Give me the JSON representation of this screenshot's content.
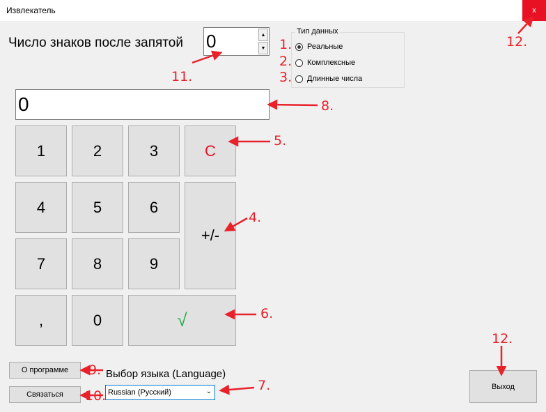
{
  "window": {
    "title": "Извлекатель",
    "close_label": "x"
  },
  "decimals": {
    "label": "Число знаков после запятой",
    "value": "0"
  },
  "data_type": {
    "title": "Тип данных",
    "options": [
      {
        "label": "Реальные",
        "selected": true
      },
      {
        "label": "Комплексные",
        "selected": false
      },
      {
        "label": "Длинные числа",
        "selected": false
      }
    ]
  },
  "display": {
    "value": "0"
  },
  "keypad": {
    "k1": "1",
    "k2": "2",
    "k3": "3",
    "clear": "C",
    "k4": "4",
    "k5": "5",
    "k6": "6",
    "sign": "+/-",
    "k7": "7",
    "k8": "8",
    "k9": "9",
    "comma": ",",
    "k0": "0",
    "sqrt": "√"
  },
  "about_button": "О программе",
  "contact_button": "Связаться",
  "language": {
    "label": "Выбор языка (Language)",
    "selected": "Russian (Русский)"
  },
  "exit_button": "Выход",
  "annotations": {
    "a1": "1.",
    "a2": "2.",
    "a3": "3.",
    "a4": "4.",
    "a5": "5.",
    "a6": "6.",
    "a7": "7.",
    "a8": "8.",
    "a9": "9.",
    "a10": "10.",
    "a11": "11.",
    "a12_top": "12.",
    "a12_bottom": "12."
  },
  "colors": {
    "annotation": "#e8212a",
    "clear_key": "#e81123",
    "sqrt_key": "#22b14c",
    "close_button": "#e81123"
  }
}
